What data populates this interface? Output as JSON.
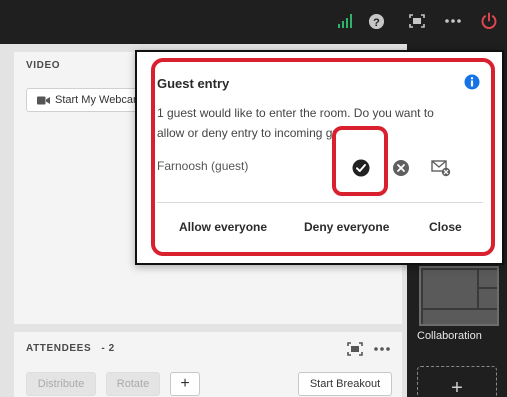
{
  "topbar": {
    "icons": [
      "signal-bars-icon",
      "help-icon",
      "fullscreen-icon",
      "more-icon",
      "power-icon"
    ],
    "colors": {
      "signal": "#2fb36a",
      "power": "#e34850"
    }
  },
  "video_pod": {
    "title": "VIDEO",
    "start_webcam_label": "Start My Webcam"
  },
  "attendees_pod": {
    "title": "ATTENDEES   - 2",
    "distribute_label": "Distribute",
    "rotate_label": "Rotate",
    "add_label": "+",
    "start_breakout_label": "Start Breakout"
  },
  "layouts_rail": {
    "collaboration_label": "Collaboration",
    "add_label": "+"
  },
  "dialog": {
    "title": "Guest entry",
    "message": "1 guest would like to enter the room. Do you want to allow or deny entry to incoming guests?",
    "guest_name": "Farnoosh (guest)",
    "allow_everyone_label": "Allow everyone",
    "deny_everyone_label": "Deny everyone",
    "close_label": "Close",
    "colors": {
      "info": "#1473e6",
      "highlight": "#d8202f"
    }
  }
}
